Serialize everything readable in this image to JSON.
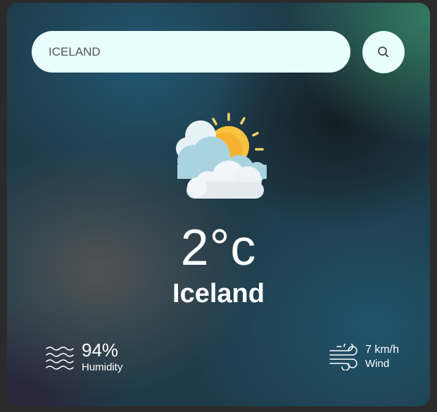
{
  "search": {
    "value": "ICELAND"
  },
  "weather": {
    "icon": "sun-behind-clouds-icon",
    "temperature": "2°c",
    "city": "Iceland"
  },
  "humidity": {
    "value": "94%",
    "label": "Humidity",
    "icon": "humidity-waves-icon"
  },
  "wind": {
    "value": "7 km/h",
    "label": "Wind",
    "icon": "wind-icon"
  },
  "colors": {
    "input_bg": "#e9fffd",
    "text": "#ffffff",
    "sun": "#f9c33e",
    "cloud": "#d9ecf2"
  }
}
